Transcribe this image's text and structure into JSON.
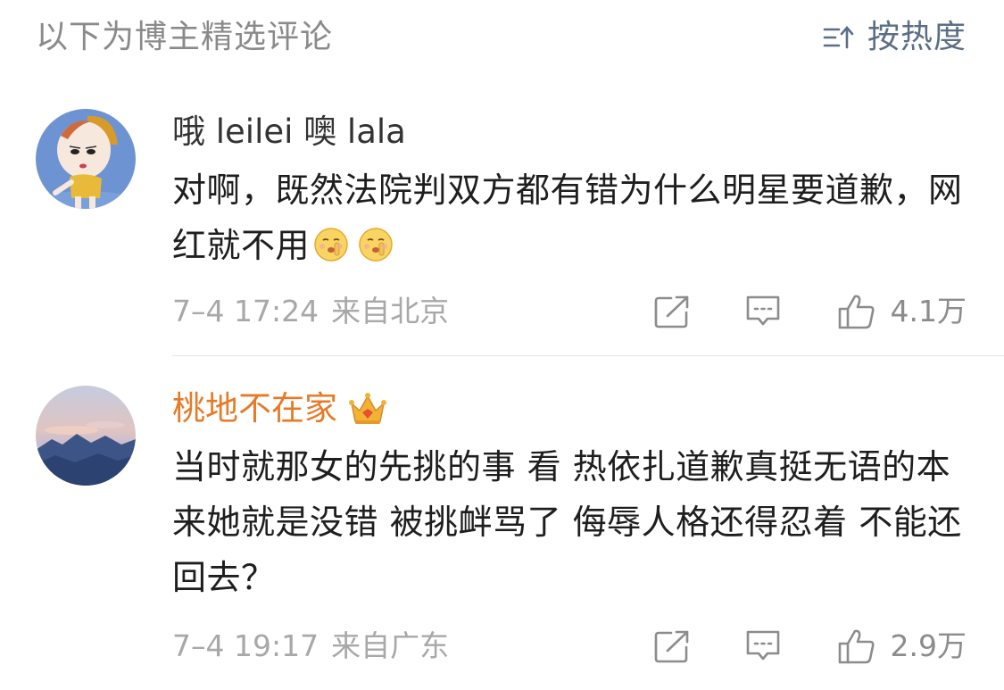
{
  "header": {
    "title": "以下为博主精选评论",
    "sort_label": "按热度",
    "sort_icon": "sort-icon"
  },
  "comments": [
    {
      "username": "哦 leilei 噢 lala",
      "text": "对啊，既然法院判双方都有错为什么明星要道歉，网红就不用",
      "emojis": [
        "shush-emoji",
        "shush-emoji"
      ],
      "time": "7–4 17:24",
      "location": "来自北京",
      "likes": "4.1万"
    },
    {
      "username": "桃地不在家",
      "badge": "crown-icon",
      "text": "当时就那女的先挑的事 看 热依扎道歉真挺无语的本来她就是没错 被挑衅骂了 侮辱人格还得忍着 不能还回去？",
      "time": "7–4 19:17",
      "location": "来自广东",
      "likes": "2.9万"
    }
  ],
  "colors": {
    "vip_name": "#e67a27",
    "sort_accent": "#5b6e86",
    "meta_gray": "#a8a8a8"
  }
}
